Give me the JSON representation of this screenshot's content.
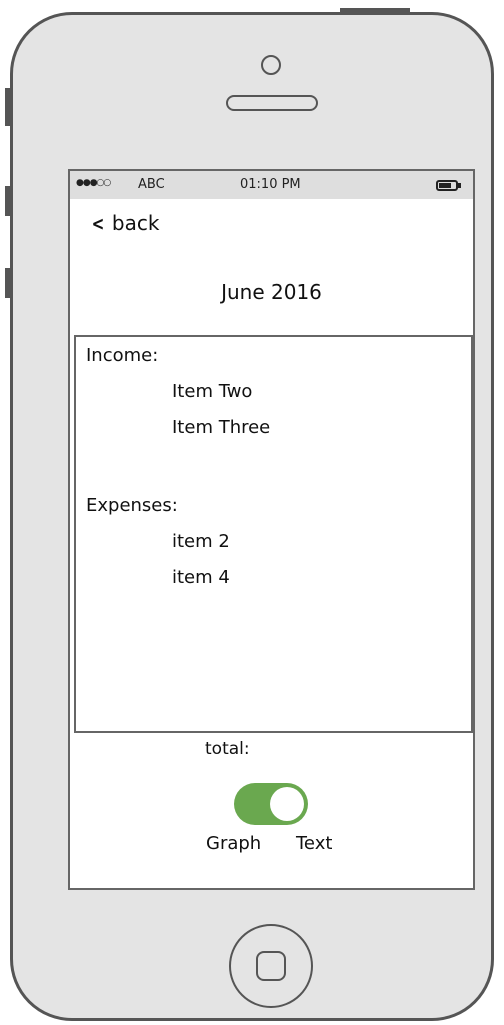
{
  "status_bar": {
    "signal": "●●●○○",
    "carrier": "ABC",
    "time": "01:10 PM"
  },
  "nav": {
    "back_label": "back"
  },
  "header": {
    "title": "June 2016"
  },
  "income": {
    "label": "Income:",
    "items": [
      "Item Two",
      "Item Three"
    ]
  },
  "expenses": {
    "label": "Expenses:",
    "items": [
      "item 2",
      "item 4"
    ]
  },
  "footer": {
    "total_label": "total:",
    "toggle_left_label": "Graph",
    "toggle_right_label": "Text",
    "toggle_on": true
  },
  "colors": {
    "toggle_accent": "#6aa84f"
  }
}
